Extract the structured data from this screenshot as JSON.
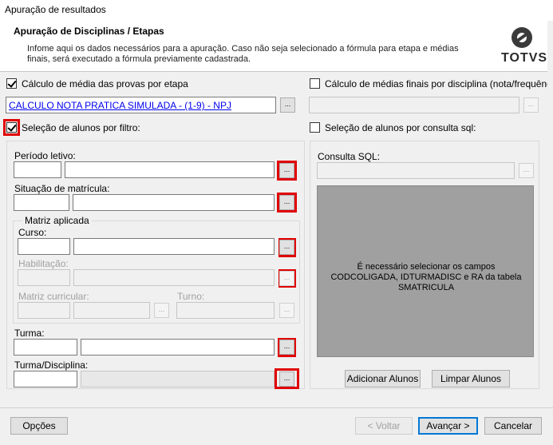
{
  "window": {
    "title": "Apuração de resultados"
  },
  "header": {
    "title": "Apuração de Disciplinas / Etapas",
    "description": "Infome aqui os dados necessários para a apuração. Caso não seja selecionado a fórmula para etapa e médias finais, será executado a fórmula previamente cadastrada.",
    "logo_text": "TOTVS"
  },
  "left": {
    "calc_etapa_label": "Cálculo de média das provas por etapa",
    "calc_etapa_checked": true,
    "formula_value": "CALCULO NOTA PRATICA SIMULADA - (1-9) - NPJ",
    "selecao_filtro_label": "Seleção de alunos por filtro:",
    "selecao_filtro_checked": true,
    "periodo_label": "Período letivo:",
    "situacao_label": "Situação de matrícula:",
    "matriz_group_label": "Matriz aplicada",
    "curso_label": "Curso:",
    "habilitacao_label": "Habilitação:",
    "matriz_curricular_label": "Matriz curricular:",
    "turno_label": "Turno:",
    "turma_label": "Turma:",
    "turma_disciplina_label": "Turma/Disciplina:",
    "dots": "..."
  },
  "right": {
    "calc_finais_label": "Cálculo de médias finais por disciplina (nota/frequência)",
    "calc_finais_checked": false,
    "selecao_sql_label": "Seleção de alunos por consulta sql:",
    "selecao_sql_checked": false,
    "consulta_label": "Consulta SQL:",
    "sql_message": "É necessário selecionar os campos CODCOLIGADA, IDTURMADISC e RA da tabela SMATRICULA",
    "add_button": "Adicionar Alunos",
    "clear_button": "Limpar Alunos"
  },
  "footer": {
    "options_button": "Opções",
    "back_button": "< Voltar",
    "next_button": "Avançar >",
    "cancel_button": "Cancelar"
  }
}
